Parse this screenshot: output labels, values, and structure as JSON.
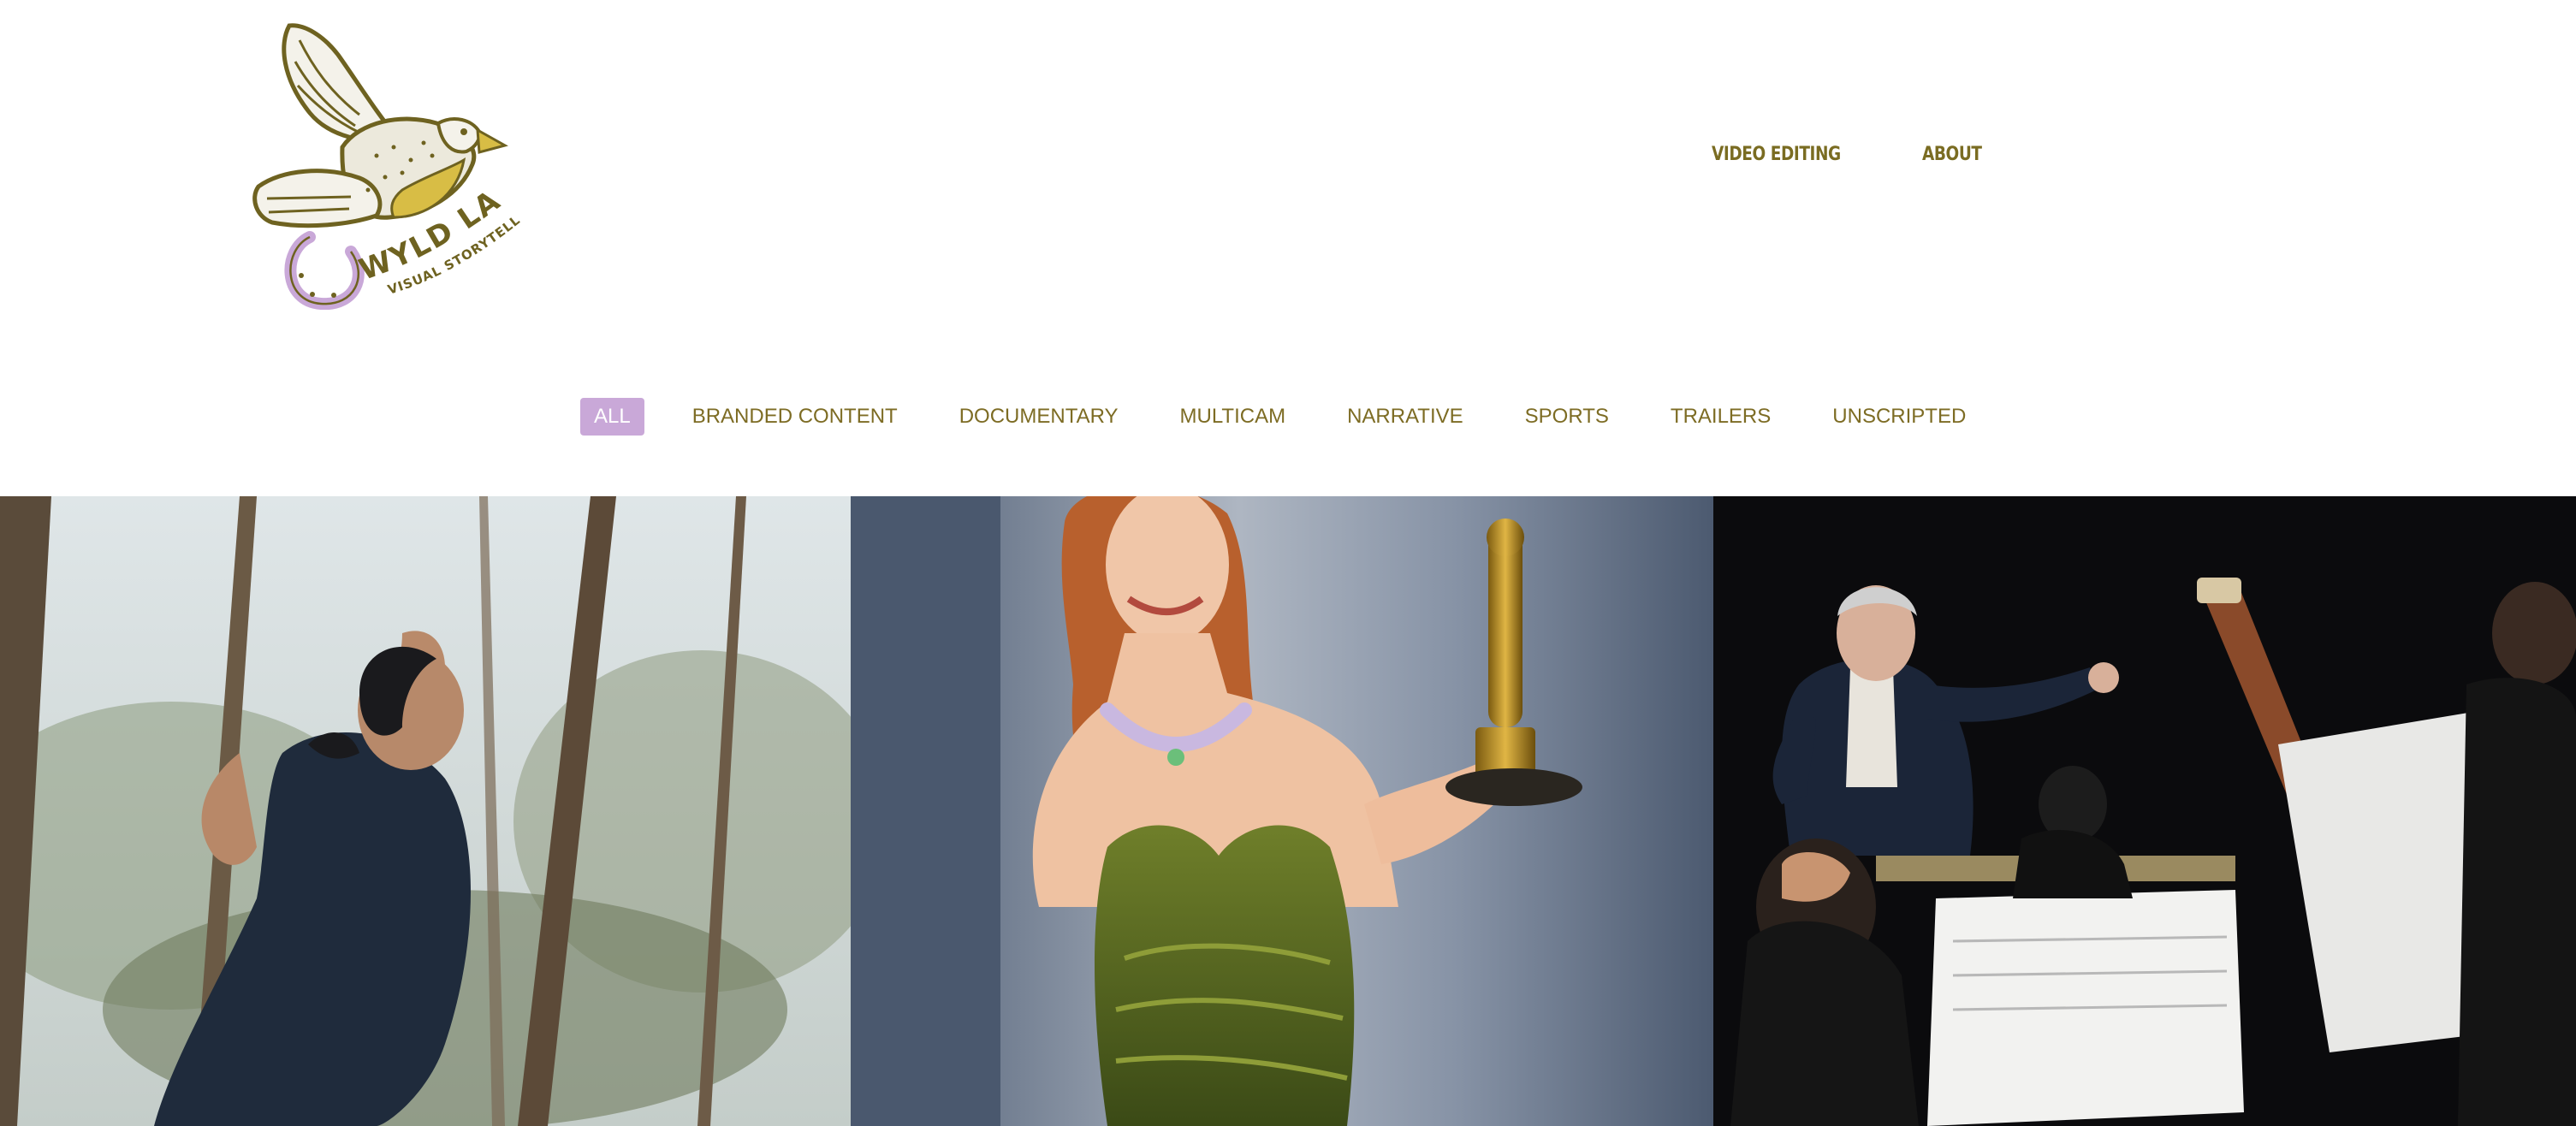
{
  "site": {
    "logo": {
      "brand_name": "WYLD LARK",
      "tagline": "VISUAL STORYTELLING",
      "icon": "lark-horseshoe-logo",
      "colors": {
        "gold": "#a8922c",
        "lilac": "#c9a8d8",
        "outline": "#6e6220"
      }
    }
  },
  "main_nav": {
    "items": [
      {
        "label": "VIDEO EDITING"
      },
      {
        "label": "ABOUT"
      }
    ]
  },
  "filters": {
    "active_index": 0,
    "active_color": "#c9a8d8",
    "text_color": "#7d6c24",
    "items": [
      {
        "label": "ALL"
      },
      {
        "label": "BRANDED CONTENT"
      },
      {
        "label": "DOCUMENTARY"
      },
      {
        "label": "MULTICAM"
      },
      {
        "label": "NARRATIVE"
      },
      {
        "label": "SPORTS"
      },
      {
        "label": "TRAILERS"
      },
      {
        "label": "UNSCRIPTED"
      }
    ]
  },
  "gallery": {
    "tiles": [
      {
        "subject": "dancer-among-pine-trees"
      },
      {
        "subject": "actress-green-gown-holding-oscar"
      },
      {
        "subject": "orchestra-conductor-on-stage"
      }
    ]
  }
}
